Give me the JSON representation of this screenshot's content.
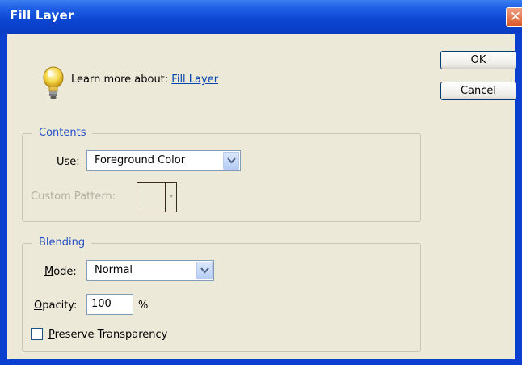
{
  "window": {
    "title": "Fill Layer",
    "close_label": "✕"
  },
  "buttons": {
    "ok": "OK",
    "cancel": "Cancel"
  },
  "learn": {
    "prefix": "Learn more about: ",
    "link": "Fill Layer"
  },
  "contents": {
    "legend": "Contents",
    "use_label_accel": "U",
    "use_label_rest": "se:",
    "use_value": "Foreground Color",
    "custom_pattern_label": "Custom Pattern:"
  },
  "blending": {
    "legend": "Blending",
    "mode_label_accel": "M",
    "mode_label_rest": "ode:",
    "mode_value": "Normal",
    "opacity_label_accel": "O",
    "opacity_label_rest": "pacity:",
    "opacity_value": "100",
    "opacity_unit": "%",
    "preserve_accel": "P",
    "preserve_rest": "reserve Transparency",
    "preserve_checked": false
  },
  "colors": {
    "accent": "#2451c7",
    "titlebar": "#0b45d0",
    "dialog_bg": "#ece9d8"
  }
}
